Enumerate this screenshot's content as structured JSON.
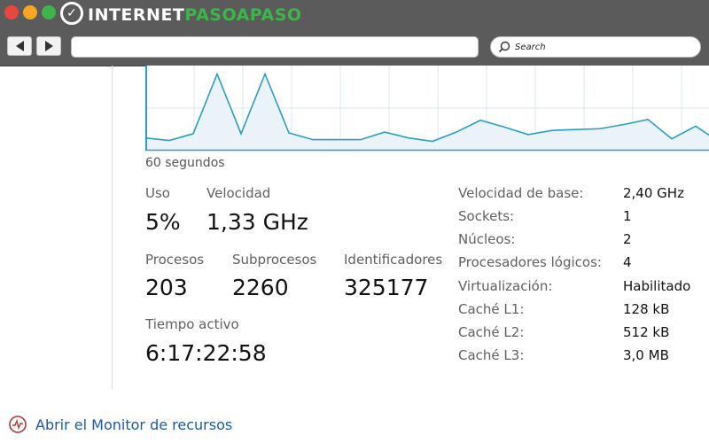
{
  "browser": {
    "logo_white": "INTERNET",
    "logo_green": "PASOAPASO",
    "address_value": "",
    "search_placeholder": "Search",
    "accent_green": "#3db54a"
  },
  "graph": {
    "caption": "60 segundos",
    "fill_color": "#e9f3f8",
    "line_color": "#2b9cc4",
    "y_max": 100,
    "values": [
      14,
      11,
      19,
      90,
      19,
      90,
      20,
      12,
      12,
      12,
      21,
      14,
      10,
      21,
      35,
      27,
      18,
      23,
      24,
      25,
      30,
      36,
      13,
      28,
      9,
      30
    ]
  },
  "stats": {
    "uso_label": "Uso",
    "uso_value": "5%",
    "velocidad_label": "Velocidad",
    "velocidad_value": "1,33 GHz",
    "procesos_label": "Procesos",
    "procesos_value": "203",
    "subprocesos_label": "Subprocesos",
    "subprocesos_value": "2260",
    "identificadores_label": "Identificadores",
    "identificadores_value": "325177",
    "tiempo_label": "Tiempo activo",
    "tiempo_value": "6:17:22:58"
  },
  "specs": [
    {
      "label": "Velocidad de base:",
      "value": "2,40 GHz"
    },
    {
      "label": "Sockets:",
      "value": "1"
    },
    {
      "label": "Núcleos:",
      "value": "2"
    },
    {
      "label": "Procesadores lógicos:",
      "value": "4"
    },
    {
      "label": "Virtualización:",
      "value": "Habilitado"
    },
    {
      "label": "Caché L1:",
      "value": "128 kB"
    },
    {
      "label": "Caché L2:",
      "value": "512 kB"
    },
    {
      "label": "Caché L3:",
      "value": "3,0 MB"
    }
  ],
  "footer": {
    "monitor_link": "Abrir el Monitor de recursos"
  }
}
